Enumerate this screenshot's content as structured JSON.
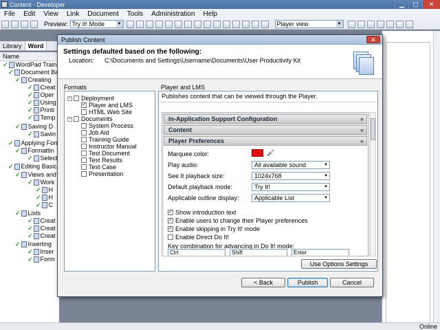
{
  "app": {
    "title": "Content - Developer",
    "window_controls": {
      "minimize": "▁",
      "maximize": "▢",
      "close": "✕"
    },
    "menu": [
      "File",
      "Edit",
      "View",
      "Link",
      "Document",
      "Tools",
      "Administration",
      "Help"
    ],
    "toolbar": {
      "preview_label": "Preview:",
      "preview_value": "Try It! Mode",
      "view_value": "Player view"
    },
    "left_tabs": [
      "Library",
      "Word"
    ],
    "name_header": "Name",
    "tree": [
      "WordPad Training",
      "Document Ba",
      "Creating",
      "Creat",
      "Oper",
      "Using",
      "Printi",
      "Temp",
      "Saving D",
      "Savin",
      "Applying Form",
      "Formattin",
      "Select",
      "Editing Basic",
      "Views and",
      "Work",
      "H",
      "H",
      "C",
      "Lists",
      "Creat",
      "Creat",
      "Creat",
      "Inserting",
      "Inser",
      "Form"
    ],
    "status": "Online"
  },
  "dialog": {
    "title": "Publish Content",
    "close": "✕",
    "heading": "Settings defaulted based on the following:",
    "location_label": "Location:",
    "location_value": "C:\\Documents and Settings\\Username\\Documents\\User Productivity Kit",
    "formats_label": "Formats",
    "formats": {
      "deployment": "Deployment",
      "player_lms": "Player and LMS",
      "html_web": "HTML Web Site",
      "documents": "Documents",
      "doc_items": [
        "System Process",
        "Job Aid",
        "Training Guide",
        "Instructor Manual",
        "Test Document",
        "Test Results",
        "Test Case",
        "Presentation"
      ]
    },
    "pane_label": "Player and LMS",
    "pane_desc": "Publishes content that can be viewed through the Player.",
    "sections": {
      "in_app": "In-Application Support Configuration",
      "content": "Content",
      "player_prefs": "Player Preferences"
    },
    "prefs": {
      "marquee_color_label": "Marquee color:",
      "marquee_color": "#e11010",
      "play_audio_label": "Play audio:",
      "play_audio_value": "All available sound",
      "see_it_label": "See It playback size:",
      "see_it_value": "1024x768",
      "default_mode_label": "Default playback mode:",
      "default_mode_value": "Try It!",
      "outline_label": "Applicable outline display:",
      "outline_value": "Applicable List",
      "cb_intro": "Show introduction text",
      "cb_change": "Enable users to change their Player preferences",
      "cb_skip": "Enable skipping in Try It! mode",
      "cb_direct": "Enable Direct Do It!",
      "key_combo_label": "Key combination for advancing in Do It! mode:",
      "combo_a": "Ctrl",
      "combo_b": "Shift",
      "combo_c": "Enter"
    },
    "use_options": "Use Options Settings",
    "back": "< Back",
    "publish": "Publish",
    "cancel": "Cancel"
  }
}
